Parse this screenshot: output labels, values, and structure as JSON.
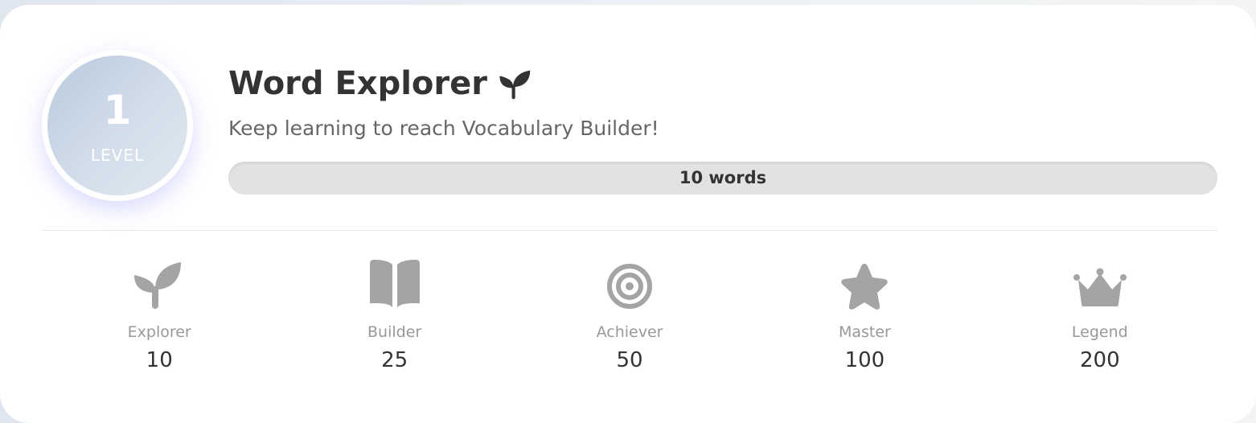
{
  "level": {
    "number": "1",
    "label": "LEVEL"
  },
  "header": {
    "title": "Word Explorer",
    "title_icon": "sprout-icon",
    "subtitle": "Keep learning to reach Vocabulary Builder!"
  },
  "progress": {
    "label": "10 words",
    "fill_fraction": 0
  },
  "milestones": [
    {
      "name": "Explorer",
      "count": "10",
      "icon": "sprout-icon"
    },
    {
      "name": "Builder",
      "count": "25",
      "icon": "book-icon"
    },
    {
      "name": "Achiever",
      "count": "50",
      "icon": "target-icon"
    },
    {
      "name": "Master",
      "count": "100",
      "icon": "star-icon"
    },
    {
      "name": "Legend",
      "count": "200",
      "icon": "crown-icon"
    }
  ],
  "colors": {
    "text_dark": "#333333",
    "text_muted": "#999999",
    "icon_gray": "#a4a4a4",
    "badge_gradient_start": "#b9c9de",
    "badge_gradient_end": "#e0e8f1",
    "progress_track": "#e2e2e2"
  }
}
